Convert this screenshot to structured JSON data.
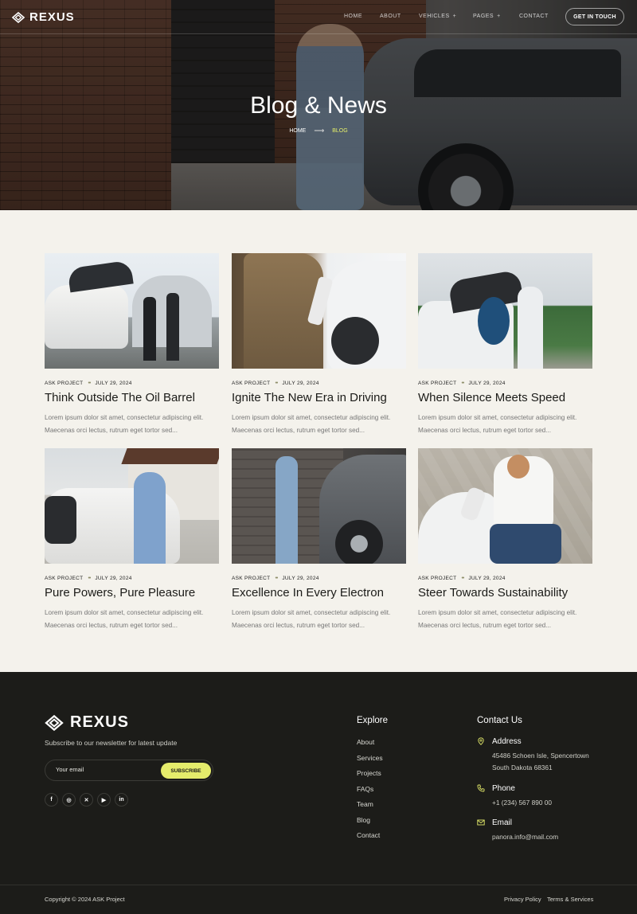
{
  "brand": "REXUS",
  "nav": {
    "links": [
      {
        "label": "HOME",
        "has_dropdown": false
      },
      {
        "label": "ABOUT",
        "has_dropdown": false
      },
      {
        "label": "VEHICLES",
        "has_dropdown": true
      },
      {
        "label": "PAGES",
        "has_dropdown": true
      },
      {
        "label": "CONTACT",
        "has_dropdown": false
      }
    ],
    "cta": "GET IN TOUCH"
  },
  "hero": {
    "title": "Blog & News",
    "breadcrumb": {
      "home": "HOME",
      "current": "BLOG"
    }
  },
  "posts": [
    {
      "category": "ASK PROJECT",
      "date": "JULY 29, 2024",
      "title": "Think Outside The Oil Barrel",
      "excerpt_line1": "Lorem ipsum dolor sit amet, consectetur adipiscing elit.",
      "excerpt_line2": "Maecenas orci lectus, rutrum eget tortor sed..."
    },
    {
      "category": "ASK PROJECT",
      "date": "JULY 29, 2024",
      "title": "Ignite The New Era in Driving",
      "excerpt_line1": "Lorem ipsum dolor sit amet, consectetur adipiscing elit.",
      "excerpt_line2": "Maecenas orci lectus, rutrum eget tortor sed..."
    },
    {
      "category": "ASK PROJECT",
      "date": "JULY 29, 2024",
      "title": "When Silence Meets Speed",
      "excerpt_line1": "Lorem ipsum dolor sit amet, consectetur adipiscing elit.",
      "excerpt_line2": "Maecenas orci lectus, rutrum eget tortor sed..."
    },
    {
      "category": "ASK PROJECT",
      "date": "JULY 29, 2024",
      "title": "Pure Powers, Pure Pleasure",
      "excerpt_line1": "Lorem ipsum dolor sit amet, consectetur adipiscing elit.",
      "excerpt_line2": "Maecenas orci lectus, rutrum eget tortor sed..."
    },
    {
      "category": "ASK PROJECT",
      "date": "JULY 29, 2024",
      "title": "Excellence In Every Electron",
      "excerpt_line1": "Lorem ipsum dolor sit amet, consectetur adipiscing elit.",
      "excerpt_line2": "Maecenas orci lectus, rutrum eget tortor sed..."
    },
    {
      "category": "ASK PROJECT",
      "date": "JULY 29, 2024",
      "title": "Steer Towards Sustainability",
      "excerpt_line1": "Lorem ipsum dolor sit amet, consectetur adipiscing elit.",
      "excerpt_line2": "Maecenas orci lectus, rutrum eget tortor sed..."
    }
  ],
  "footer": {
    "newsletter_text": "Subscribe to our newsletter for latest update",
    "email_placeholder": "Your email",
    "subscribe_label": "SUBSCRIBE",
    "socials": [
      {
        "icon": "facebook-icon",
        "glyph": "f"
      },
      {
        "icon": "instagram-icon",
        "glyph": "◎"
      },
      {
        "icon": "x-icon",
        "glyph": "✕"
      },
      {
        "icon": "youtube-icon",
        "glyph": "▶"
      },
      {
        "icon": "linkedin-icon",
        "glyph": "in"
      }
    ],
    "explore": {
      "title": "Explore",
      "items": [
        "About",
        "Services",
        "Projects",
        "FAQs",
        "Team",
        "Blog",
        "Contact"
      ]
    },
    "contact": {
      "title": "Contact Us",
      "address_label": "Address",
      "address_line1": "45486 Schoen Isle, Spencertown",
      "address_line2": "South Dakota 68361",
      "phone_label": "Phone",
      "phone": "+1 (234) 567 890 00",
      "email_label": "Email",
      "email": "panora.info@mail.com"
    },
    "copyright": "Copyright © 2024 ASK Project",
    "privacy": "Privacy Policy",
    "terms": "Terms & Services"
  },
  "colors": {
    "accent": "#e5ec6b",
    "footer_bg": "#1c1c19",
    "page_bg": "#f4f2ec"
  }
}
